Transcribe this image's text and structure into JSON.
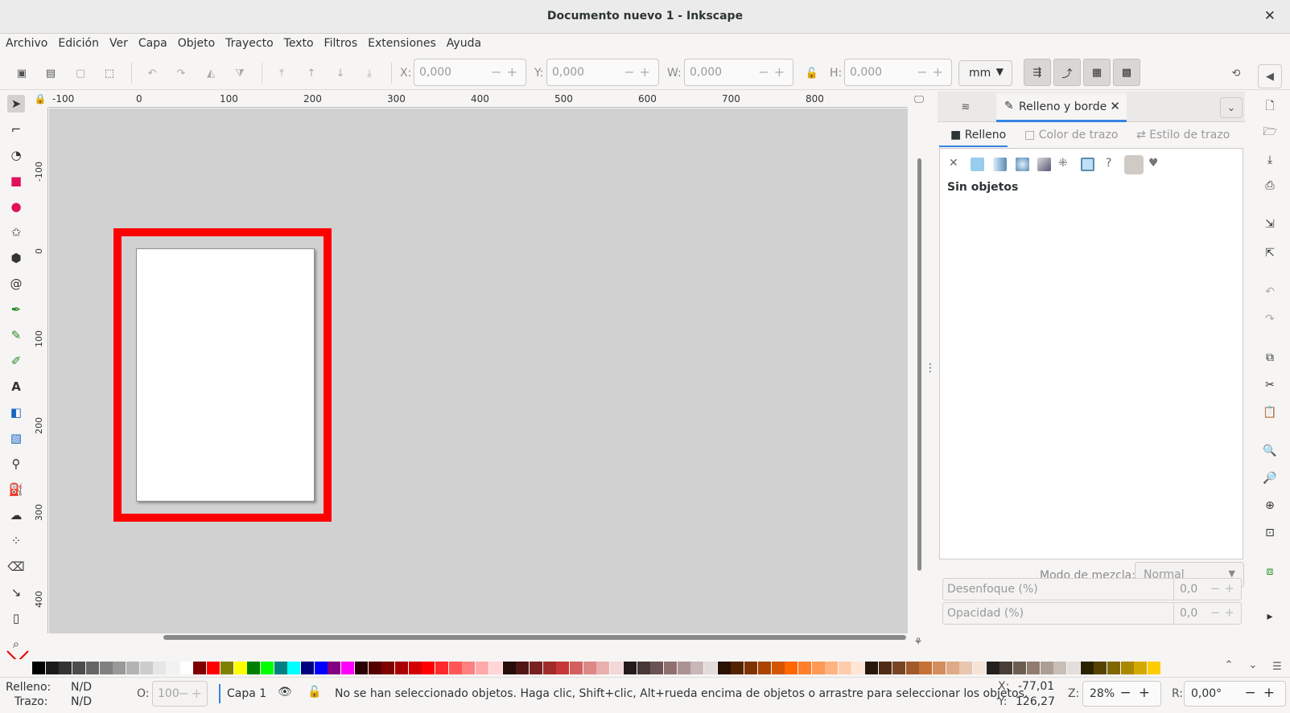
{
  "window": {
    "title": "Documento nuevo 1 - Inkscape",
    "close_icon": "close-icon"
  },
  "menu": [
    "Archivo",
    "Edición",
    "Ver",
    "Capa",
    "Objeto",
    "Trayecto",
    "Texto",
    "Filtros",
    "Extensiones",
    "Ayuda"
  ],
  "controls": {
    "x_label": "X:",
    "x_value": "0,000",
    "y_label": "Y:",
    "y_value": "0,000",
    "w_label": "W:",
    "w_value": "0,000",
    "h_label": "H:",
    "h_value": "0,000",
    "unit": "mm"
  },
  "ruler_h": [
    "-100",
    "0",
    "100",
    "200",
    "300",
    "400",
    "500",
    "600",
    "700",
    "800"
  ],
  "ruler_v": [
    "-100",
    "0",
    "100",
    "200",
    "300",
    "400"
  ],
  "panel": {
    "tab_label": "Relleno y borde",
    "subtabs": [
      "Relleno",
      "Color de trazo",
      "Estilo de trazo"
    ],
    "no_objects": "Sin objetos",
    "blend_label": "Modo de mezcla:",
    "blend_value": "Normal",
    "blur_label": "Desenfoque (%)",
    "blur_value": "0,0",
    "opacity_label": "Opacidad (%)",
    "opacity_value": "0,0"
  },
  "status": {
    "fill_label": "Relleno:",
    "fill_value": "N/D",
    "stroke_label": "Trazo:",
    "stroke_value": "N/D",
    "o_label": "O:",
    "o_value": "100",
    "layer": "Capa 1",
    "message": "No se han seleccionado objetos. Haga clic, Shift+clic, Alt+rueda encima de objetos o arrastre para seleccionar los objetos.",
    "cursor_x_label": "X:",
    "cursor_x": "-77,01",
    "cursor_y_label": "Y:",
    "cursor_y": "126,27",
    "zoom_label": "Z:",
    "zoom": "28%",
    "rotation_label": "R:",
    "rotation": "0,00°"
  },
  "palette": [
    "#000000",
    "#1a1a1a",
    "#333333",
    "#4d4d4d",
    "#666666",
    "#808080",
    "#999999",
    "#b3b3b3",
    "#cccccc",
    "#e6e6e6",
    "#f2f2f2",
    "#ffffff",
    "#800000",
    "#ff0000",
    "#808000",
    "#ffff00",
    "#008000",
    "#00ff00",
    "#008080",
    "#00ffff",
    "#000080",
    "#0000ff",
    "#800080",
    "#ff00ff",
    "#2b0000",
    "#550000",
    "#800000",
    "#aa0000",
    "#d40000",
    "#ff0000",
    "#ff2a2a",
    "#ff5555",
    "#ff8080",
    "#ffaaaa",
    "#ffd5d5",
    "#280b0b",
    "#501616",
    "#782121",
    "#a02c2c",
    "#c83737",
    "#d35f5f",
    "#de8787",
    "#e9afaf",
    "#f4d7d7",
    "#241c1c",
    "#483737",
    "#6c5353",
    "#916f6f",
    "#ac9393",
    "#c8b7b7",
    "#e3dbdb",
    "#2b1100",
    "#552200",
    "#803300",
    "#aa4400",
    "#d45500",
    "#ff6600",
    "#ff7f2a",
    "#ff9955",
    "#ffb380",
    "#ffccaa",
    "#ffe6d5",
    "#28170b",
    "#502d16",
    "#784421",
    "#a05a2c",
    "#c87137",
    "#d38d5f",
    "#deaa87",
    "#e9c6af",
    "#f4e3d7",
    "#241f1c",
    "#483e37",
    "#6c5d53",
    "#917c6f",
    "#ac9d93",
    "#c8beb7",
    "#e3dedb",
    "#2b2200",
    "#554400",
    "#806600",
    "#aa8800",
    "#d4aa00",
    "#ffcc00"
  ]
}
